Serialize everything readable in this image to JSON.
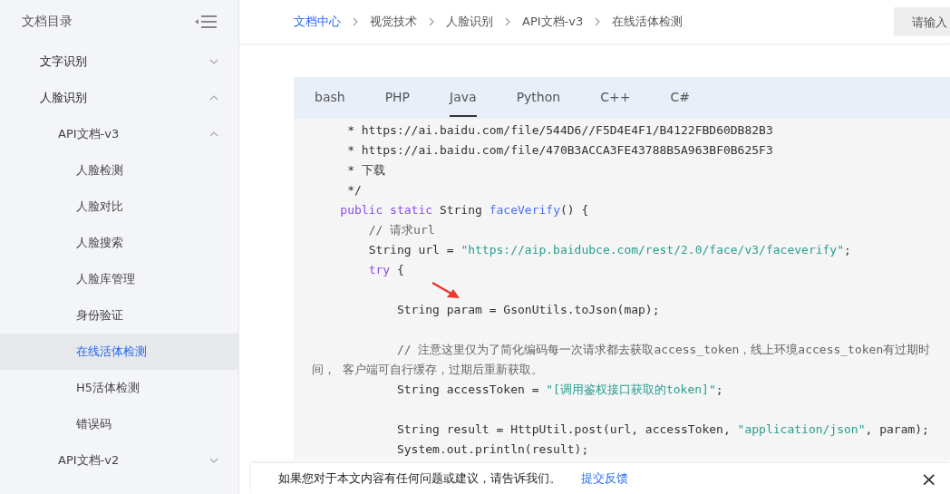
{
  "sidebar": {
    "title": "文档目录",
    "items": [
      {
        "label": "文字识别",
        "expanded": false,
        "selected": false
      },
      {
        "label": "人脸识别",
        "expanded": true,
        "selected": false,
        "children": [
          {
            "label": "API文档-v3",
            "expanded": true,
            "selected": false,
            "children": [
              {
                "label": "人脸检测",
                "selected": false
              },
              {
                "label": "人脸对比",
                "selected": false
              },
              {
                "label": "人脸搜索",
                "selected": false
              },
              {
                "label": "人脸库管理",
                "selected": false
              },
              {
                "label": "身份验证",
                "selected": false
              },
              {
                "label": "在线活体检测",
                "selected": true
              },
              {
                "label": "H5活体检测",
                "selected": false
              },
              {
                "label": "错误码",
                "selected": false
              }
            ]
          },
          {
            "label": "API文档-v2",
            "expanded": false,
            "selected": false
          }
        ]
      }
    ]
  },
  "breadcrumb": [
    {
      "label": "文档中心",
      "link": true
    },
    {
      "label": "视觉技术",
      "link": false
    },
    {
      "label": "人脸识别",
      "link": false
    },
    {
      "label": "API文档-v3",
      "link": false
    },
    {
      "label": "在线活体检测",
      "link": false
    }
  ],
  "search": {
    "placeholder": "请输入"
  },
  "tabs": [
    {
      "label": "bash",
      "selected": false
    },
    {
      "label": "PHP",
      "selected": false
    },
    {
      "label": "Java",
      "selected": true
    },
    {
      "label": "Python",
      "selected": false
    },
    {
      "label": "C++",
      "selected": false
    },
    {
      "label": "C#",
      "selected": false
    }
  ],
  "code": [
    {
      "tokens": [
        {
          "kind": "plain",
          "text": "     * https://ai.baidu.com/file/544D6//F5D4E4F1/B4122FBD60DB82B3"
        }
      ]
    },
    {
      "tokens": [
        {
          "kind": "plain",
          "text": "     * https://ai.baidu.com/file/470B3ACCA3FE43788B5A963BF0B625F3"
        }
      ]
    },
    {
      "tokens": [
        {
          "kind": "plain",
          "text": "     * 下载"
        }
      ]
    },
    {
      "tokens": [
        {
          "kind": "plain",
          "text": "     */"
        }
      ]
    },
    {
      "tokens": [
        {
          "kind": "keyword",
          "text": "    public static "
        },
        {
          "kind": "plain",
          "text": "String "
        },
        {
          "kind": "function",
          "text": "faceVerify"
        },
        {
          "kind": "plain",
          "text": "() {"
        }
      ]
    },
    {
      "tokens": [
        {
          "kind": "comment",
          "text": "        // 请求url"
        }
      ]
    },
    {
      "tokens": [
        {
          "kind": "plain",
          "text": "        String url = "
        },
        {
          "kind": "string",
          "text": "\"https://aip.baidubce.com/rest/2.0/face/v3/faceverify\""
        },
        {
          "kind": "plain",
          "text": ";"
        }
      ]
    },
    {
      "tokens": [
        {
          "kind": "keyword",
          "text": "        try "
        },
        {
          "kind": "plain",
          "text": "{"
        }
      ]
    },
    {
      "blank_before": true,
      "tokens": [
        {
          "kind": "plain",
          "text": "            String param = GsonUtils.toJson(map);"
        }
      ]
    },
    {
      "blank_before": true,
      "tokens": [
        {
          "kind": "comment",
          "text": "            // 注意这里仅为了简化编码每一次请求都去获取access_token，线上环境access_token有过期时间， 客户端可自行缓存，过期后重新获取。"
        }
      ]
    },
    {
      "tokens": [
        {
          "kind": "plain",
          "text": "            String accessToken = "
        },
        {
          "kind": "string",
          "text": "\"[调用鉴权接口获取的token]\""
        },
        {
          "kind": "plain",
          "text": ";"
        }
      ]
    },
    {
      "blank_before": true,
      "tokens": [
        {
          "kind": "plain",
          "text": "            String result = HttpUtil.post(url, accessToken, "
        },
        {
          "kind": "string",
          "text": "\"application/json\""
        },
        {
          "kind": "plain",
          "text": ", param);"
        }
      ]
    },
    {
      "tokens": [
        {
          "kind": "plain",
          "text": "            System.out.println(result);"
        }
      ]
    }
  ],
  "feedback": {
    "text": "如果您对于本文内容有任何问题或建议，请告诉我们。",
    "link": "提交反馈",
    "close": "×"
  }
}
